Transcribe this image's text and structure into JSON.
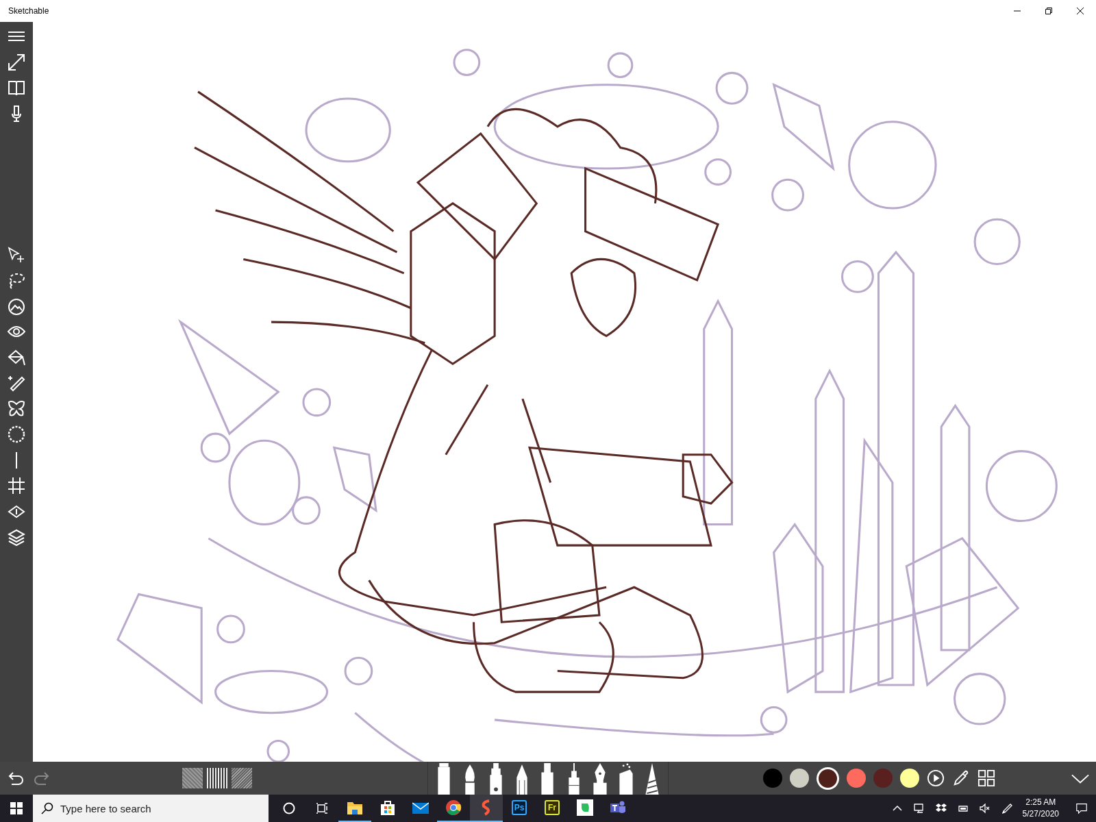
{
  "window": {
    "title": "Sketchable"
  },
  "swatches": [
    {
      "color": "#000000",
      "selected": false
    },
    {
      "color": "#cfcfc4",
      "selected": false
    },
    {
      "color": "#4f1f1a",
      "selected": true
    },
    {
      "color": "#ff6a5e",
      "selected": false
    },
    {
      "color": "#5a2020",
      "selected": false
    },
    {
      "color": "#ffff99",
      "selected": false
    }
  ],
  "taskbar": {
    "search": {
      "placeholder": "Type here to search"
    },
    "apps": [
      {
        "kind": "explorer",
        "running": true
      },
      {
        "kind": "store",
        "running": false
      },
      {
        "kind": "mail",
        "running": false
      },
      {
        "kind": "chrome",
        "running": true
      },
      {
        "kind": "sketchable",
        "running": true
      },
      {
        "kind": "ps",
        "label": "Ps",
        "running": false
      },
      {
        "kind": "fr",
        "label": "Fr",
        "running": false
      },
      {
        "kind": "evernote",
        "running": false
      },
      {
        "kind": "teams",
        "running": false
      }
    ],
    "time": "2:25 AM",
    "date": "5/27/2020"
  }
}
